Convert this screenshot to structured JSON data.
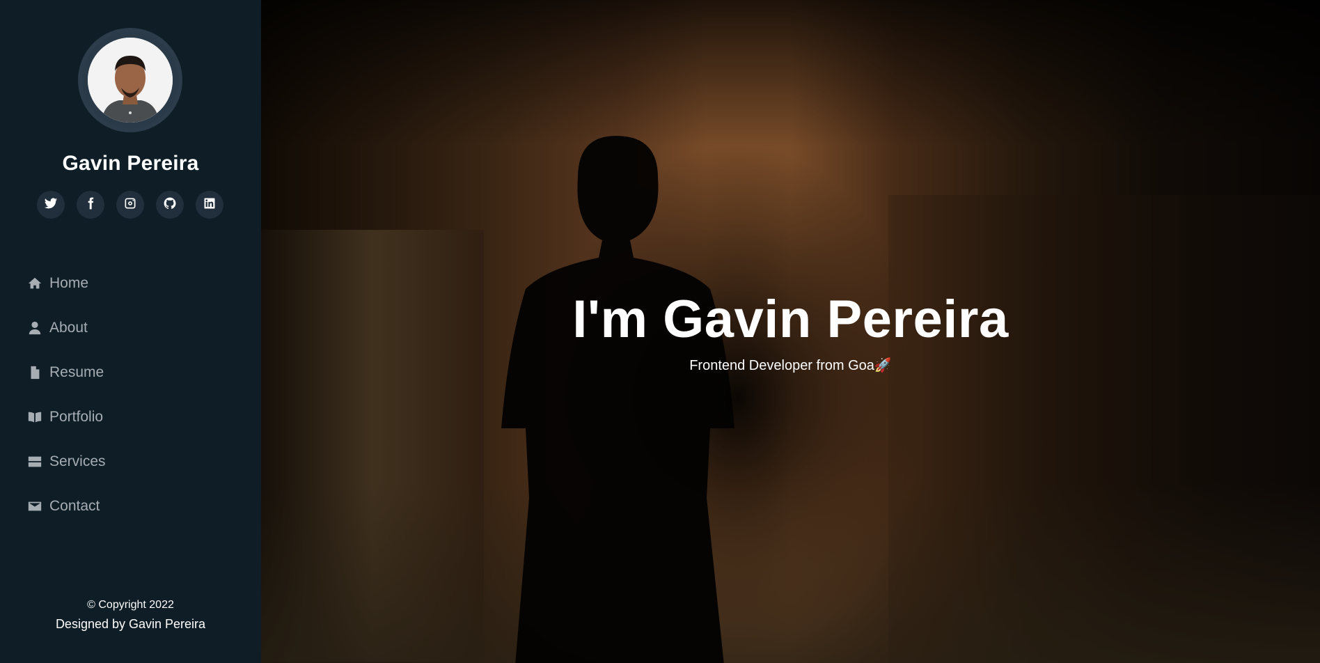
{
  "profile": {
    "name": "Gavin Pereira"
  },
  "social": [
    {
      "icon": "twitter-icon"
    },
    {
      "icon": "facebook-icon"
    },
    {
      "icon": "instagram-icon"
    },
    {
      "icon": "github-icon"
    },
    {
      "icon": "linkedin-icon"
    }
  ],
  "nav": {
    "items": [
      {
        "label": "Home",
        "icon": "home-icon"
      },
      {
        "label": "About",
        "icon": "user-icon"
      },
      {
        "label": "Resume",
        "icon": "file-icon"
      },
      {
        "label": "Portfolio",
        "icon": "book-icon"
      },
      {
        "label": "Services",
        "icon": "server-icon"
      },
      {
        "label": "Contact",
        "icon": "envelope-icon"
      }
    ]
  },
  "footer": {
    "copyright": "© Copyright 2022",
    "designed": "Designed by Gavin Pereira"
  },
  "hero": {
    "title": "I'm Gavin Pereira",
    "subtitle": "Frontend Developer from Goa🚀"
  },
  "colors": {
    "sidebar_bg": "#0e1d26",
    "social_bg": "#212f3c",
    "nav_text": "#a6adb3"
  }
}
